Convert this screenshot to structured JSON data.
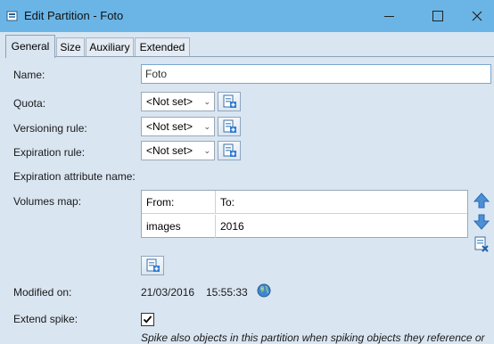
{
  "window": {
    "title": "Edit Partition - Foto"
  },
  "tabs": [
    {
      "label": "General",
      "active": true
    },
    {
      "label": "Size",
      "active": false
    },
    {
      "label": "Auxiliary",
      "active": false
    },
    {
      "label": "Extended",
      "active": false
    }
  ],
  "form": {
    "name_label": "Name:",
    "name_value": "Foto",
    "quota_label": "Quota:",
    "quota_value": "<Not set>",
    "versioning_label": "Versioning rule:",
    "versioning_value": "<Not set>",
    "expiration_label": "Expiration rule:",
    "expiration_value": "<Not set>",
    "expiration_attr_label": "Expiration attribute name:",
    "volumes_label": "Volumes map:",
    "volumes_table": {
      "columns": [
        "From:",
        "To:"
      ],
      "rows": [
        [
          "images",
          "2016"
        ]
      ]
    },
    "modified_label": "Modified on:",
    "modified_date": "21/03/2016",
    "modified_time": "15:55:33",
    "extend_spike_label": "Extend spike:",
    "extend_spike_checked": true,
    "extend_spike_description": "Spike also objects in this partition when spiking objects they reference or"
  },
  "colors": {
    "titlebar": "#6bb5e6",
    "panel": "#d9e5f1",
    "input_border": "#7aa7cf"
  }
}
